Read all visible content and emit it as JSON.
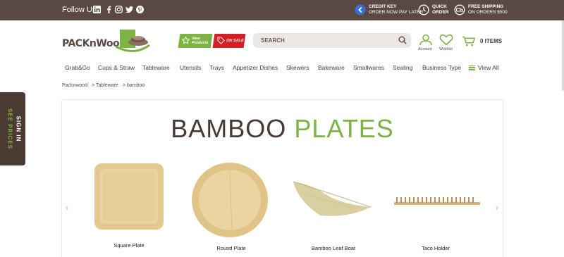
{
  "topbar": {
    "follow_label": "Follow Us",
    "social": [
      "linkedin-icon",
      "facebook-icon",
      "instagram-icon",
      "twitter-icon",
      "pinterest-icon"
    ],
    "promos": [
      {
        "icon": "credit-key-icon",
        "title": "CREDIT KEY",
        "subtitle": "ORDER NOW PAY LATER"
      },
      {
        "icon": "quick-order-icon",
        "title": "QUICK",
        "subtitle": "ORDER"
      },
      {
        "icon": "free-shipping-icon",
        "title": "FREE SHIPPING",
        "subtitle": "ON ORDERS $500"
      }
    ]
  },
  "header": {
    "logo_text": "PACKnWood",
    "badge_new": "New Products",
    "badge_sale": "ON SALE",
    "search_placeholder": "SEARCH",
    "account_label": "Account",
    "wishlist_label": "Wishlist",
    "cart_label": "0 ITEMS"
  },
  "nav": {
    "items": [
      "Grab&Go",
      "Cups & Straw",
      "Tableware",
      "Utensils",
      "Trays",
      "Appetizer Dishes",
      "Skewers",
      "Bakeware",
      "Smallwares",
      "Sealing",
      "Business Type"
    ],
    "view_all": "View All"
  },
  "breadcrumb": [
    "Packnwood",
    "> Tableware",
    "> bamboo"
  ],
  "sidetab": {
    "line1": "SEE PRICES",
    "line2": "SIGN IN"
  },
  "main": {
    "heading_word1": "BAMBOO",
    "heading_word2": "PLATES",
    "products": [
      {
        "label": "Square Plate"
      },
      {
        "label": "Round Plate"
      },
      {
        "label": "Bamboo Leaf Boat"
      },
      {
        "label": "Taco Holder"
      }
    ]
  },
  "colors": {
    "brown": "#5a4842",
    "green": "#7cb342",
    "red": "#d32027"
  }
}
